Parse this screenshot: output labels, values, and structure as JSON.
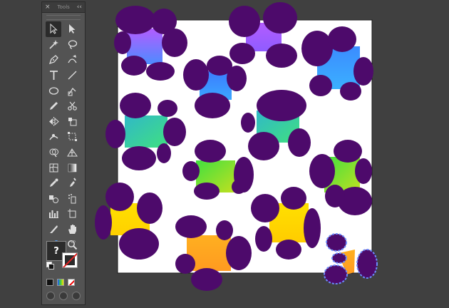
{
  "toolbar": {
    "title": "Tools",
    "close_glyph": "×",
    "collapse_glyph": "‹‹",
    "tools": [
      {
        "name": "selection-tool",
        "icon": "arrow-black-icon",
        "selected": true
      },
      {
        "name": "direct-selection-tool",
        "icon": "arrow-white-icon"
      },
      {
        "name": "magic-wand-tool",
        "icon": "magic-wand-icon"
      },
      {
        "name": "lasso-tool",
        "icon": "lasso-icon"
      },
      {
        "name": "pen-tool",
        "icon": "pen-icon"
      },
      {
        "name": "curvature-tool",
        "icon": "curvature-icon"
      },
      {
        "name": "type-tool",
        "icon": "type-icon",
        "glyph": "T"
      },
      {
        "name": "line-segment-tool",
        "icon": "line-icon"
      },
      {
        "name": "ellipse-tool",
        "icon": "ellipse-icon"
      },
      {
        "name": "shaper-tool",
        "icon": "shaper-icon"
      },
      {
        "name": "pencil-tool",
        "icon": "pencil-icon"
      },
      {
        "name": "scissors-tool",
        "icon": "scissors-icon"
      },
      {
        "name": "reflect-tool",
        "icon": "reflect-icon"
      },
      {
        "name": "scale-tool",
        "icon": "scale-icon"
      },
      {
        "name": "puppet-warp-tool",
        "icon": "puppet-warp-icon"
      },
      {
        "name": "free-transform-tool",
        "icon": "free-transform-icon"
      },
      {
        "name": "shape-builder-tool",
        "icon": "shape-builder-icon"
      },
      {
        "name": "perspective-grid-tool",
        "icon": "perspective-icon"
      },
      {
        "name": "mesh-tool",
        "icon": "mesh-icon"
      },
      {
        "name": "gradient-tool",
        "icon": "gradient-icon"
      },
      {
        "name": "eyedropper-tool",
        "icon": "eyedropper-icon"
      },
      {
        "name": "measure-tool",
        "icon": "eyedropper-measure-icon"
      },
      {
        "name": "blend-tool",
        "icon": "blend-icon"
      },
      {
        "name": "symbol-sprayer-tool",
        "icon": "symbol-sprayer-icon"
      },
      {
        "name": "column-graph-tool",
        "icon": "column-graph-icon"
      },
      {
        "name": "artboard-tool",
        "icon": "artboard-icon"
      },
      {
        "name": "slice-tool",
        "icon": "slice-icon"
      },
      {
        "name": "hand-tool",
        "icon": "hand-icon"
      },
      {
        "name": "edit-toolbar-tool",
        "icon": "toolbar-edit-icon"
      },
      {
        "name": "zoom-tool",
        "icon": "zoom-icon"
      }
    ],
    "fill_label": "?",
    "swap_glyph": "↶"
  },
  "colors": {
    "canvas": "#404040",
    "artboard": "#ffffff",
    "purple": "#4d0a6b",
    "selection": "#6b8cff"
  },
  "artwork": {
    "spots": [
      {
        "id": "spot-1",
        "colors": [
          "#b35cff",
          "#4d8cff"
        ]
      },
      {
        "id": "spot-2",
        "colors": [
          "#b35cff",
          "#8f5cff"
        ]
      },
      {
        "id": "spot-3",
        "colors": [
          "#3b7cff",
          "#3ba7ff"
        ]
      },
      {
        "id": "spot-4",
        "colors": [
          "#3b8cff",
          "#3bb0ff"
        ]
      },
      {
        "id": "spot-5",
        "colors": [
          "#30b8c8",
          "#40e080"
        ]
      },
      {
        "id": "spot-6",
        "colors": [
          "#30b8c8",
          "#40e080"
        ]
      },
      {
        "id": "spot-7",
        "colors": [
          "#40e040",
          "#c0e020"
        ]
      },
      {
        "id": "spot-8",
        "colors": [
          "#40e040",
          "#c0e020"
        ]
      },
      {
        "id": "spot-9",
        "colors": [
          "#ffe000",
          "#ffd000"
        ]
      },
      {
        "id": "spot-10",
        "colors": [
          "#ffe000",
          "#ffcc00"
        ]
      },
      {
        "id": "spot-11",
        "colors": [
          "#ffb020",
          "#ff9a20"
        ]
      },
      {
        "id": "spot-12",
        "colors": [
          "#ffb020",
          "#ff9a20"
        ]
      }
    ]
  }
}
